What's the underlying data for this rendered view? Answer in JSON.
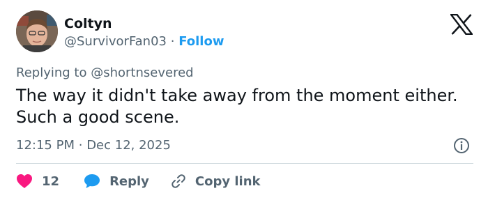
{
  "author": {
    "name": "Coltyn",
    "handle": "@SurvivorFan03",
    "separator": "·",
    "follow_label": "Follow"
  },
  "icons": {
    "brand": "x-logo-icon",
    "info": "info-icon",
    "like": "heart-icon",
    "reply": "speech-bubble-icon",
    "copy": "link-icon"
  },
  "colors": {
    "accent": "#1d9bf0",
    "like": "#f91880",
    "muted": "#536471",
    "text": "#0f1419"
  },
  "replying": {
    "prefix": "Replying to",
    "mention": "@shortnsevered"
  },
  "tweet": {
    "text": "The way it didn't take away from the moment either. Such a good scene."
  },
  "meta": {
    "time": "12:15 PM",
    "separator": "·",
    "date": "Dec 12, 2025"
  },
  "actions": {
    "like_count": "12",
    "reply_label": "Reply",
    "copy_label": "Copy link"
  }
}
